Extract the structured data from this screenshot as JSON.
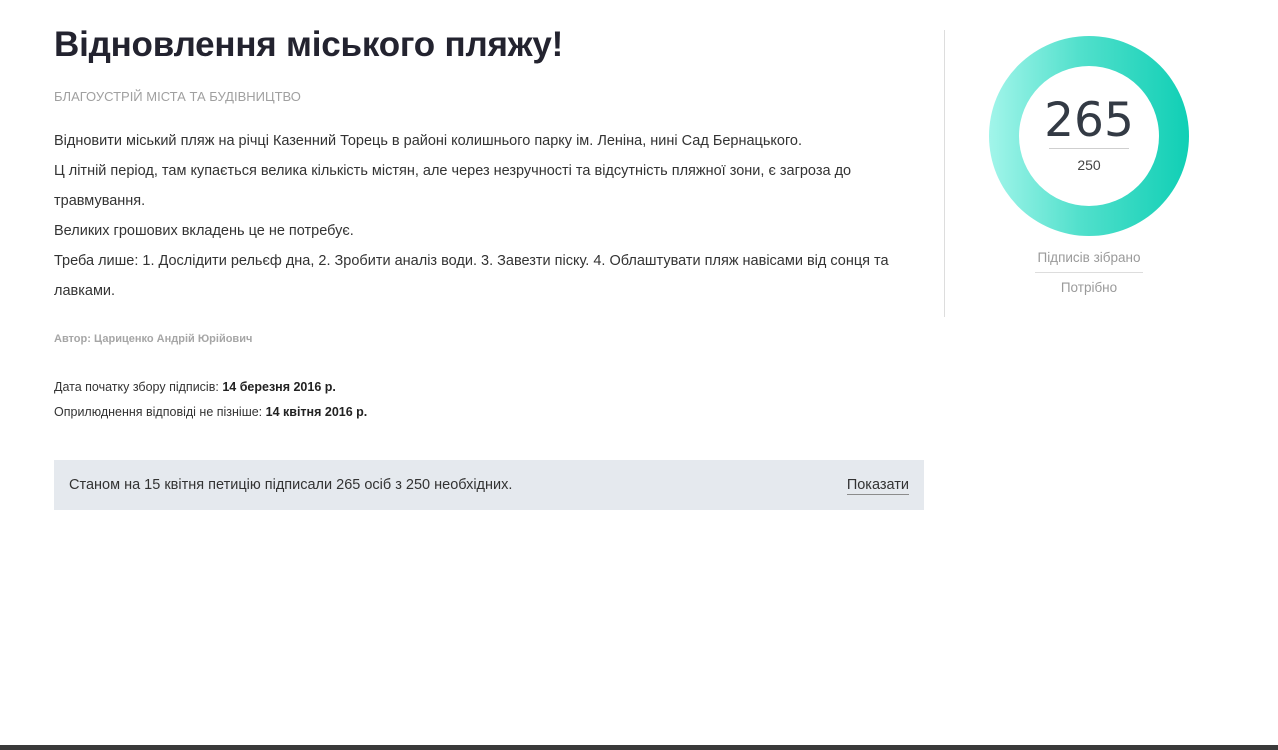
{
  "petition": {
    "title": "Відновлення міського пляжу!",
    "category": "БЛАГОУСТРІЙ МІСТА ТА БУДІВНИЦТВО",
    "description": [
      "Відновити міський пляж на річці Казенний Торець в районі колишнього парку ім. Леніна, нині Сад Бернацького.",
      "Ц літній період, там купається велика кількість містян, але через незручності та відсутність пляжної зони, є загроза до травмування.",
      "Великих грошових вкладень це не потребує.",
      "Треба лише: 1. Дослідити рельєф дна, 2. Зробити аналіз води. 3. Завезти піску. 4. Облаштувати пляж навісами від сонця та лавками."
    ],
    "author": "Автор: Цариценко Андрій Юрійович",
    "start_date_label": "Дата початку збору підписів:",
    "start_date_value": "14 березня 2016 р.",
    "response_date_label": "Оприлюднення відповіді не пізніше:",
    "response_date_value": "14 квітня 2016 р."
  },
  "status": {
    "text": "Станом на 15 квітня петицію підписали 265 осіб з 250 необхідних.",
    "show_label": "Показати"
  },
  "counter": {
    "collected": "265",
    "required": "250",
    "collected_label": "Підписів зібрано",
    "required_label": "Потрібно",
    "gradient_start": "#a2f5ea",
    "gradient_end": "#10cfb5"
  }
}
